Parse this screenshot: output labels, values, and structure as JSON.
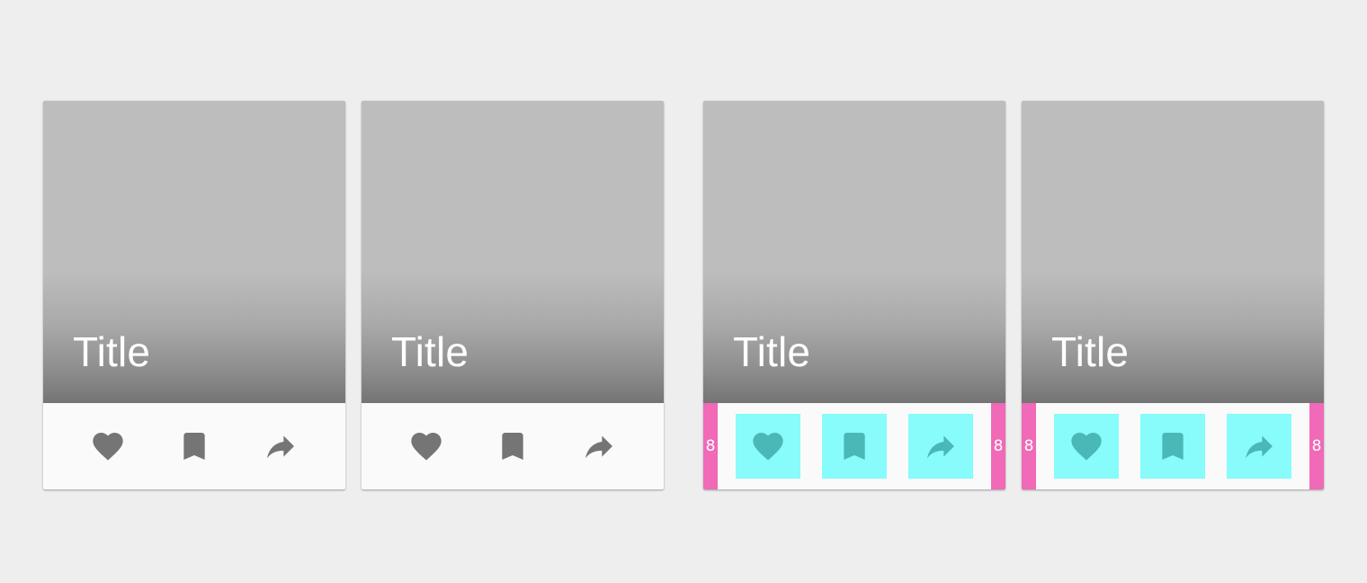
{
  "cards": [
    {
      "title": "Title",
      "annotated": false
    },
    {
      "title": "Title",
      "annotated": false
    },
    {
      "title": "Title",
      "annotated": true,
      "padding_left": "8",
      "padding_right": "8"
    },
    {
      "title": "Title",
      "annotated": true,
      "padding_left": "8",
      "padding_right": "8"
    }
  ],
  "icons": {
    "action_1": "heart-icon",
    "action_2": "bookmark-icon",
    "action_3": "share-icon"
  },
  "colors": {
    "background": "#eeeeee",
    "card_surface": "#fafafa",
    "media_placeholder": "#bdbdbd",
    "icon": "#757575",
    "title_text": "#ffffff",
    "touch_target_highlight": "#88fbfb",
    "highlighted_icon": "#4bb8b8",
    "padding_marker": "#f06ab8"
  }
}
